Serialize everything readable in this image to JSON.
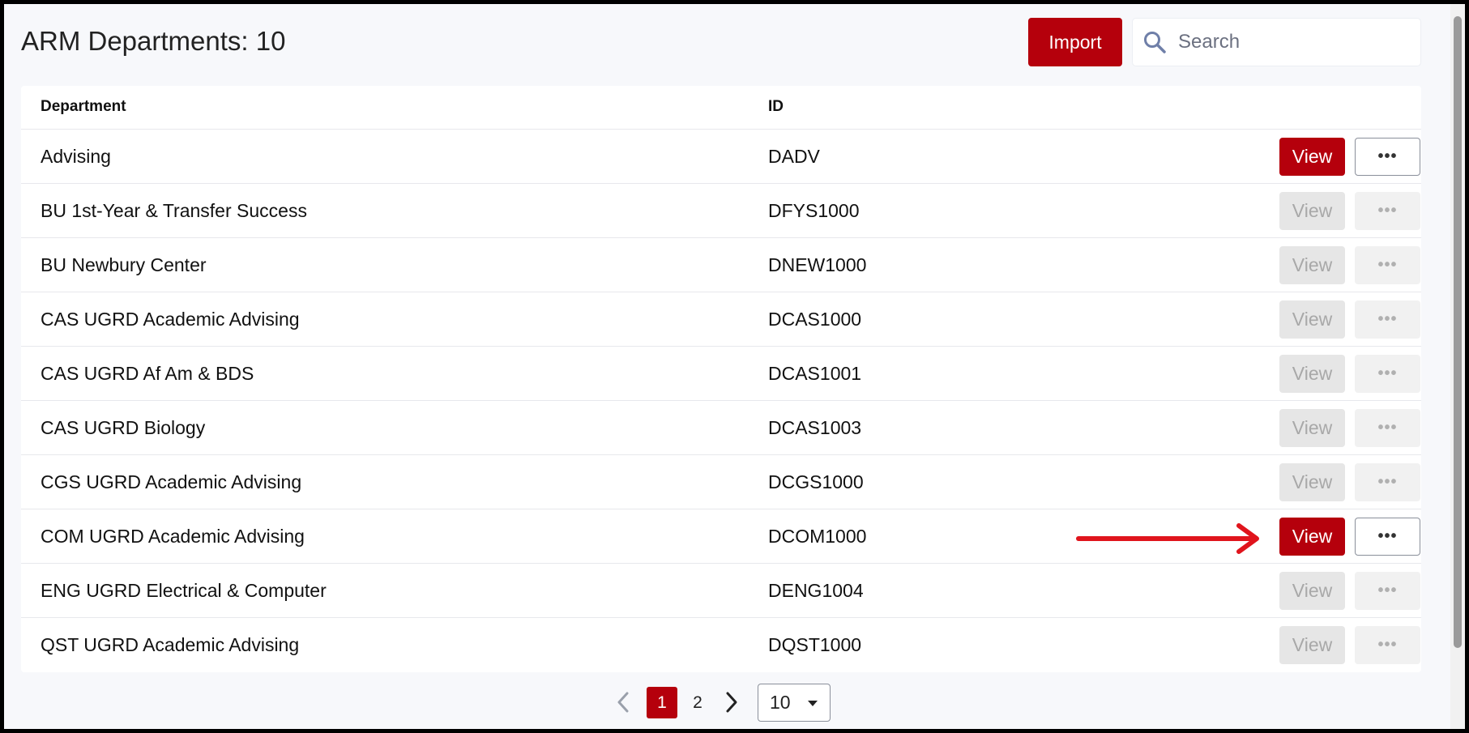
{
  "header": {
    "title": "ARM Departments: 10",
    "import_label": "Import",
    "search_placeholder": "Search"
  },
  "table": {
    "columns": [
      "Department",
      "ID"
    ],
    "rows": [
      {
        "department": "Advising",
        "id": "DADV",
        "view_label": "View",
        "enabled": true
      },
      {
        "department": "BU 1st-Year & Transfer Success",
        "id": "DFYS1000",
        "view_label": "View",
        "enabled": false
      },
      {
        "department": "BU Newbury Center",
        "id": "DNEW1000",
        "view_label": "View",
        "enabled": false
      },
      {
        "department": "CAS UGRD Academic Advising",
        "id": "DCAS1000",
        "view_label": "View",
        "enabled": false
      },
      {
        "department": "CAS UGRD Af Am & BDS",
        "id": "DCAS1001",
        "view_label": "View",
        "enabled": false
      },
      {
        "department": "CAS UGRD Biology",
        "id": "DCAS1003",
        "view_label": "View",
        "enabled": false
      },
      {
        "department": "CGS UGRD Academic Advising",
        "id": "DCGS1000",
        "view_label": "View",
        "enabled": false
      },
      {
        "department": "COM UGRD Academic Advising",
        "id": "DCOM1000",
        "view_label": "View",
        "enabled": true
      },
      {
        "department": "ENG UGRD Electrical & Computer",
        "id": "DENG1004",
        "view_label": "View",
        "enabled": false
      },
      {
        "department": "QST UGRD Academic Advising",
        "id": "DQST1000",
        "view_label": "View",
        "enabled": false
      }
    ]
  },
  "pagination": {
    "pages": [
      "1",
      "2"
    ],
    "current_page": "1",
    "page_size": "10"
  },
  "colors": {
    "accent": "#b5000c",
    "annotation_arrow": "#e0141c"
  },
  "annotation": {
    "arrow_target": "COM UGRD Academic Advising view button"
  }
}
